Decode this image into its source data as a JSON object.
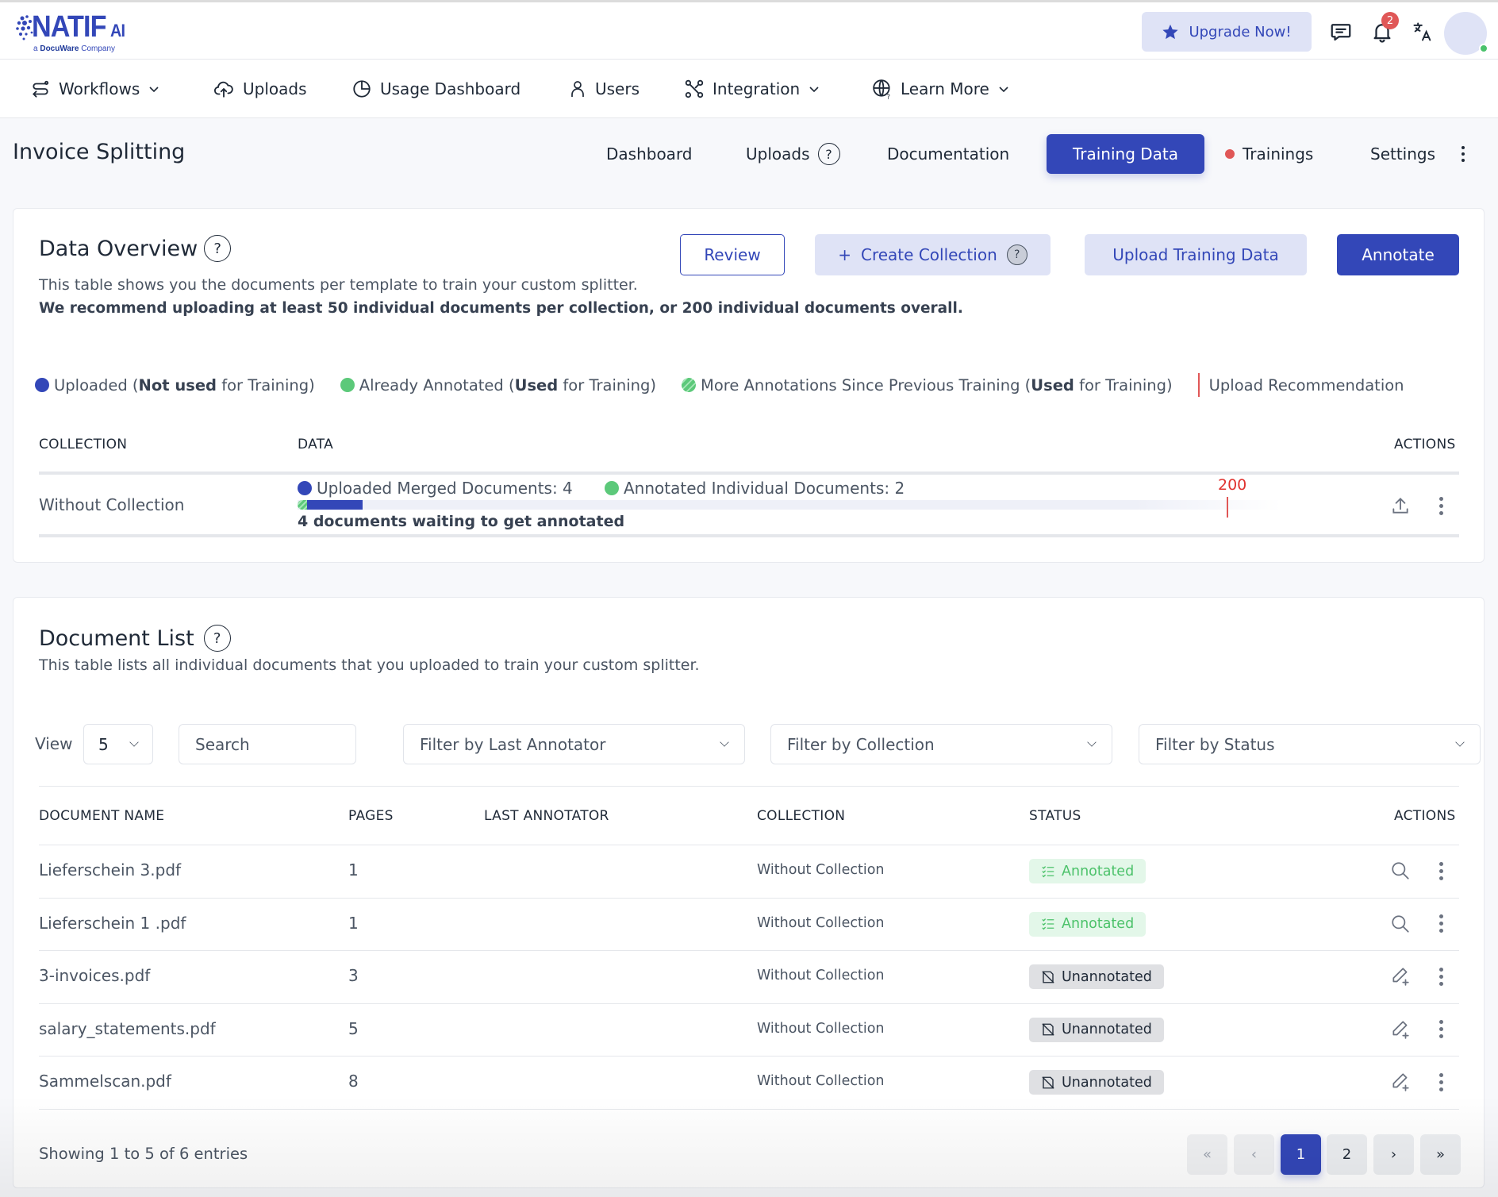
{
  "brand": {
    "name": "NATIF",
    "suffix": "AI",
    "tagline_prefix": "a ",
    "tagline_company": "DocuWare",
    "tagline_suffix": " Company",
    "accent_color": "#3347b8"
  },
  "topbar": {
    "upgrade_label": "Upgrade Now!",
    "notifications_count": "2",
    "icons": [
      "star-icon",
      "chat-icon",
      "bell-icon",
      "translate-icon",
      "avatar"
    ]
  },
  "nav": {
    "items": [
      {
        "label": "Workflows",
        "icon": "workflow-icon",
        "dropdown": true
      },
      {
        "label": "Uploads",
        "icon": "cloud-upload-icon",
        "dropdown": false
      },
      {
        "label": "Usage Dashboard",
        "icon": "pie-chart-icon",
        "dropdown": false
      },
      {
        "label": "Users",
        "icon": "user-icon",
        "dropdown": false
      },
      {
        "label": "Integration",
        "icon": "integration-icon",
        "dropdown": true
      },
      {
        "label": "Learn More",
        "icon": "globe-help-icon",
        "dropdown": true
      }
    ]
  },
  "page": {
    "title": "Invoice Splitting",
    "tabs": [
      {
        "label": "Dashboard",
        "active": false
      },
      {
        "label": "Uploads",
        "active": false,
        "help": "?"
      },
      {
        "label": "Documentation",
        "active": false
      },
      {
        "label": "Training Data",
        "active": true
      },
      {
        "label": "Trainings",
        "active": false,
        "indicator": "red-dot"
      },
      {
        "label": "Settings",
        "active": false
      }
    ]
  },
  "data_overview": {
    "title": "Data Overview",
    "help": "?",
    "description": "This table shows you the documents per template to train your custom splitter.",
    "recommendation": "We recommend uploading at least 50 individual documents per collection, or 200 individual documents overall.",
    "buttons": {
      "review": "Review",
      "create_collection": "Create Collection",
      "create_collection_prefix": "+",
      "upload_training_data": "Upload Training Data",
      "annotate": "Annotate"
    },
    "legend": [
      {
        "pre": "Uploaded (",
        "bold": "Not used",
        "post": " for Training)",
        "marker": "blue"
      },
      {
        "pre": "Already Annotated (",
        "bold": "Used",
        "post": " for Training)",
        "marker": "green"
      },
      {
        "pre": "More Annotations Since Previous Training (",
        "bold": "Used",
        "post": " for Training)",
        "marker": "striped"
      },
      {
        "pre": "Upload Recommendation",
        "bold": "",
        "post": "",
        "marker": "red-line"
      }
    ],
    "columns": {
      "collection": "COLLECTION",
      "data": "DATA",
      "actions": "ACTIONS"
    },
    "rows": [
      {
        "collection": "Without Collection",
        "uploaded_label": "Uploaded Merged Documents: 4",
        "annotated_label": "Annotated Individual Documents: 2",
        "waiting_label": "4 documents waiting to get annotated",
        "recommendation_value": "200",
        "uploaded": 4,
        "annotated": 2,
        "recommended": 200
      }
    ]
  },
  "document_list": {
    "title": "Document List",
    "help": "?",
    "description": "This table lists all individual documents that you uploaded to train your custom splitter.",
    "view_label": "View",
    "view_value": "5",
    "search_placeholder": "Search",
    "filters": {
      "last_annotator": "Filter by Last Annotator",
      "collection": "Filter by Collection",
      "status": "Filter by Status"
    },
    "columns": {
      "name": "DOCUMENT NAME",
      "pages": "PAGES",
      "last_annotator": "LAST ANNOTATOR",
      "collection": "COLLECTION",
      "status": "STATUS",
      "actions": "ACTIONS"
    },
    "rows": [
      {
        "name": "Lieferschein 3.pdf",
        "pages": "1",
        "last_annotator": "",
        "collection": "Without Collection",
        "status": "Annotated",
        "action": "search-icon"
      },
      {
        "name": "Lieferschein 1 .pdf",
        "pages": "1",
        "last_annotator": "",
        "collection": "Without Collection",
        "status": "Annotated",
        "action": "search-icon"
      },
      {
        "name": "3-invoices.pdf",
        "pages": "3",
        "last_annotator": "",
        "collection": "Without Collection",
        "status": "Unannotated",
        "action": "edit-plus-icon"
      },
      {
        "name": "salary_statements.pdf",
        "pages": "5",
        "last_annotator": "",
        "collection": "Without Collection",
        "status": "Unannotated",
        "action": "edit-plus-icon"
      },
      {
        "name": "Sammelscan.pdf",
        "pages": "8",
        "last_annotator": "",
        "collection": "Without Collection",
        "status": "Unannotated",
        "action": "edit-plus-icon"
      }
    ],
    "footer": {
      "showing": "Showing 1 to 5 of 6 entries",
      "pagination": {
        "first": "«",
        "prev": "‹",
        "pages": [
          "1",
          "2"
        ],
        "current": "1",
        "next": "›",
        "last": "»"
      }
    }
  },
  "colors": {
    "primary": "#3347b8",
    "primary_soft": "#dfe3f6",
    "annotated_bg": "#e3f7e9",
    "annotated_text": "#4cc26a",
    "unannotated_bg": "#dfe0e3",
    "alert_red": "#e05757"
  }
}
